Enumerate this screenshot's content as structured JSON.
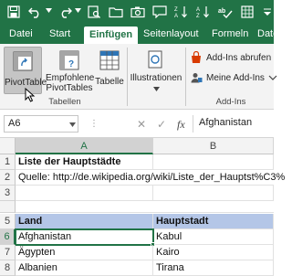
{
  "ribbon_tabs": [
    {
      "label": "Datei"
    },
    {
      "label": "Start"
    },
    {
      "label": "Einfügen"
    },
    {
      "label": "Seitenlayout"
    },
    {
      "label": "Formeln"
    },
    {
      "label": "Daten"
    }
  ],
  "active_tab": "Einfügen",
  "ribbon": {
    "pivottable_label": "PivotTable",
    "recommended_label_line1": "Empfohlene",
    "recommended_label_line2": "PivotTables",
    "tabelle_label": "Tabelle",
    "illustrationen_label": "Illustrationen",
    "addins_get_label": "Add-Ins abrufen",
    "my_addins_label": "Meine Add-Ins",
    "group_tabellen": "Tabellen",
    "group_addins": "Add-Ins"
  },
  "formula_bar": {
    "name_box": "A6",
    "fx": "fx",
    "cancel": "✕",
    "enter": "✓",
    "value": "Afghanistan"
  },
  "columns": [
    "A",
    "B"
  ],
  "rows": [
    {
      "num": "1",
      "a": "Liste der Hauptstädte",
      "b": ""
    },
    {
      "num": "2",
      "a": "Quelle: http://de.wikipedia.org/wiki/Liste_der_Hauptst%C3%",
      "b": ""
    },
    {
      "num": "3",
      "a": "",
      "b": ""
    },
    {
      "num": "5",
      "a": "Land",
      "b": "Hauptstadt"
    },
    {
      "num": "6",
      "a": "Afghanistan",
      "b": "Kabul"
    },
    {
      "num": "7",
      "a": "Ägypten",
      "b": "Kairo"
    },
    {
      "num": "8",
      "a": "Albanien",
      "b": "Tirana"
    }
  ],
  "colors": {
    "accent": "#217346",
    "header_fill": "#b4c6e7",
    "selected_button": "#c5c5c5"
  }
}
